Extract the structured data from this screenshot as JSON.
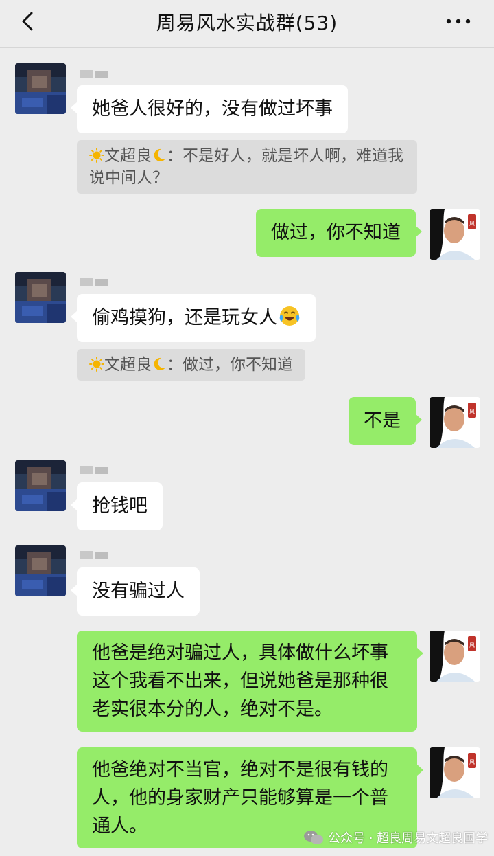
{
  "header": {
    "title": "周易风水实战群(53)",
    "back_icon": "chevron-left-icon",
    "more_icon": "more-dots-icon"
  },
  "messages": [
    {
      "side": "in",
      "text": "她爸人很好的，没有做过坏事"
    },
    {
      "side": "in_quote",
      "sender": "文超良",
      "text": "：不是好人，就是坏人啊，难道我说中间人？"
    },
    {
      "side": "out",
      "text": "做过，你不知道"
    },
    {
      "side": "in",
      "text": "偷鸡摸狗，还是玩女人"
    },
    {
      "side": "in_quote",
      "sender": "文超良",
      "text": "：做过，你不知道"
    },
    {
      "side": "out",
      "text": "不是"
    },
    {
      "side": "in",
      "text": "抢钱吧"
    },
    {
      "side": "in",
      "text": "没有骗过人"
    },
    {
      "side": "out",
      "text": "他爸是绝对骗过人，具体做什么坏事这个我看不出来，但说她爸是那种很老实很本分的人，绝对不是。"
    },
    {
      "side": "out",
      "text": "他爸绝对不当官，绝对不是很有钱的人，他的身家财产只能够算是一个普通人。"
    }
  ],
  "quote1_line1": "：不是好人，就是坏人啊，难",
  "quote1_line2": "道我说中间人？",
  "watermark": "公众号 · 超良周易文超良国学",
  "colors": {
    "bg": "#ededed",
    "out_bubble": "#95ec69",
    "in_bubble": "#ffffff",
    "quote_bg": "#dcdcdc"
  }
}
